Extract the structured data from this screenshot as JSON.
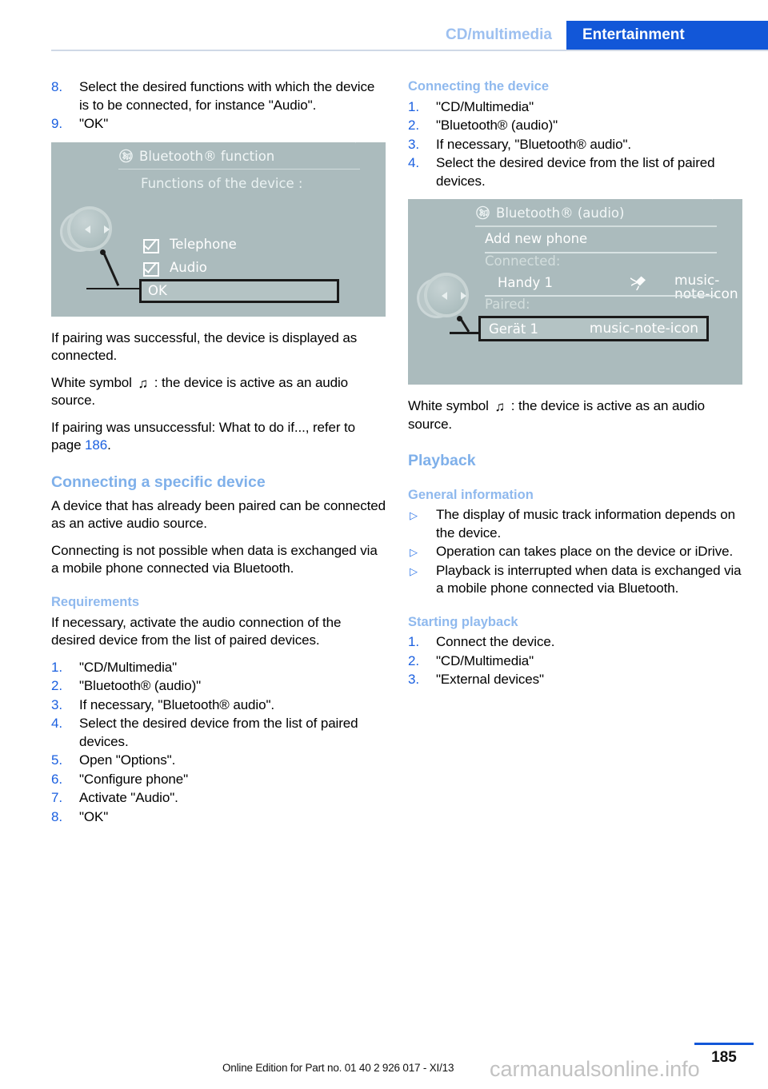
{
  "header": {
    "breadcrumb_inactive": "CD/multimedia",
    "breadcrumb_active": "Entertainment"
  },
  "left_column": {
    "steps_top": [
      {
        "num": "8.",
        "text": "Select the desired functions with which the device is to be connected, for instance \"Audio\"."
      },
      {
        "num": "9.",
        "text": "\"OK\""
      }
    ],
    "figure1": {
      "title": "Bluetooth® function",
      "subtitle": "Functions of the device :",
      "checkbox_items": [
        "Telephone",
        "Audio"
      ],
      "highlight": "OK",
      "icon_title": "bluetooth-audio-icon"
    },
    "para_success": "If pairing was successful, the device is displayed as connected.",
    "para_symbol_before": "White symbol",
    "para_symbol_glyph": "♫",
    "para_symbol_after": ": the device is active as an audio source.",
    "para_fail_before": "If pairing was unsuccessful: What to do if..., refer to page ",
    "para_fail_pageref": "186",
    "para_fail_after": ".",
    "heading_connecting_specific": "Connecting a specific device",
    "para_already_paired": "A device that has already been paired can be connected as an active audio source.",
    "para_not_possible": "Connecting is not possible when data is exchanged via a mobile phone connected via Bluetooth.",
    "heading_requirements": "Requirements",
    "para_requirements": "If necessary, activate the audio connection of the desired device from the list of paired devices.",
    "steps_requirements": [
      {
        "num": "1.",
        "text": "\"CD/Multimedia\""
      },
      {
        "num": "2.",
        "text": "\"Bluetooth® (audio)\""
      },
      {
        "num": "3.",
        "text": "If necessary, \"Bluetooth® audio\"."
      },
      {
        "num": "4.",
        "text": "Select the desired device from the list of paired devices."
      },
      {
        "num": "5.",
        "text": "Open \"Options\"."
      },
      {
        "num": "6.",
        "text": "\"Configure phone\""
      },
      {
        "num": "7.",
        "text": "Activate \"Audio\"."
      },
      {
        "num": "8.",
        "text": "\"OK\""
      }
    ]
  },
  "right_column": {
    "heading_connecting_device": "Connecting the device",
    "steps_connecting": [
      {
        "num": "1.",
        "text": "\"CD/Multimedia\""
      },
      {
        "num": "2.",
        "text": "\"Bluetooth® (audio)\""
      },
      {
        "num": "3.",
        "text": "If necessary, \"Bluetooth® audio\"."
      },
      {
        "num": "4.",
        "text": "Select the desired device from the list of paired devices."
      }
    ],
    "figure2": {
      "title": "Bluetooth® (audio)",
      "row_add": "Add new phone",
      "label_connected": "Connected:",
      "device_connected": "Handy 1",
      "label_paired": "Paired:",
      "device_paired": "Gerät 1",
      "icon_title": "bluetooth-audio-icon",
      "icon_phone": "phone-icon",
      "icon_note": "music-note-icon"
    },
    "para_symbol_before": "White symbol",
    "para_symbol_glyph": "♫",
    "para_symbol_after": ": the device is active as an audio source.",
    "heading_playback": "Playback",
    "heading_general_info": "General information",
    "bullets_general": [
      "The display of music track information depends on the device.",
      "Operation can takes place on the device or iDrive.",
      "Playback is interrupted when data is exchanged via a mobile phone connected via Bluetooth."
    ],
    "bullet_marker": "▷",
    "heading_starting_playback": "Starting playback",
    "steps_starting": [
      {
        "num": "1.",
        "text": "Connect the device."
      },
      {
        "num": "2.",
        "text": "\"CD/Multimedia\""
      },
      {
        "num": "3.",
        "text": "\"External devices\""
      }
    ]
  },
  "footer": {
    "edition_text": "Online Edition for Part no. 01 40 2 926 017 - XI/13",
    "page_number": "185",
    "watermark": "carmanualsonline.info"
  },
  "colors": {
    "accent_blue": "#1257d8",
    "tab_inactive": "#9dc0f0",
    "heading_blue": "#7fb0ea",
    "subheading_blue": "#8fb9ee",
    "idrive_bg": "#abbbbd"
  }
}
